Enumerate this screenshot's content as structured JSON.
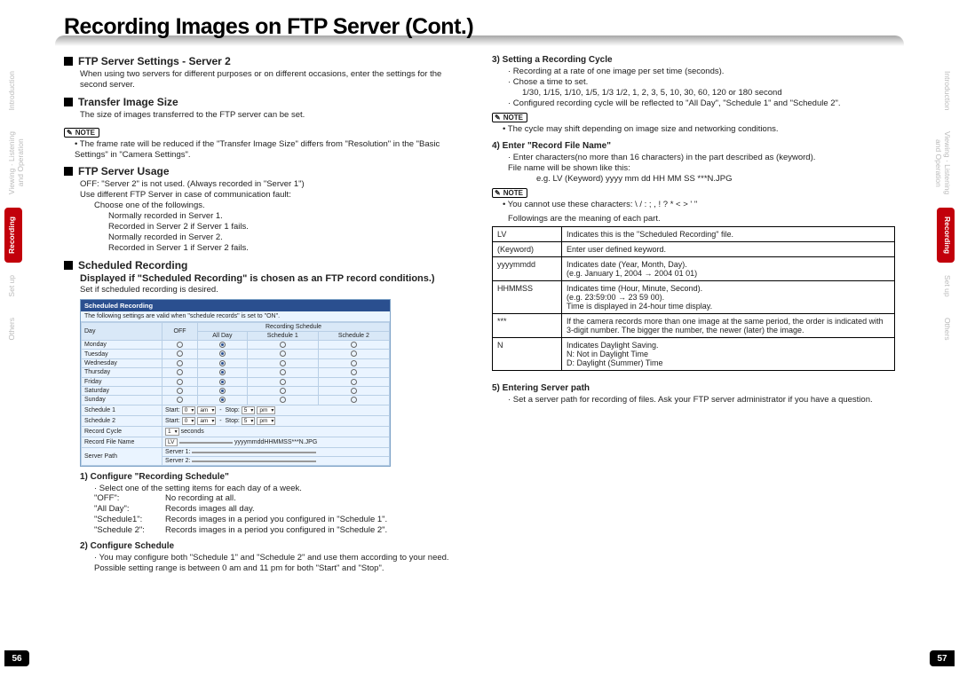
{
  "title": "Recording Images on FTP Server (Cont.)",
  "left_tabs": [
    "Introduction",
    "Viewing · Listening\nand Operation",
    "Recording",
    "Set up",
    "Others"
  ],
  "right_tabs": [
    "Introduction",
    "Viewing · Listening\nand Operation",
    "Recording",
    "Set up",
    "Others"
  ],
  "active_tab": "Recording",
  "page_left": "56",
  "page_right": "57",
  "colA": {
    "s1_h": "FTP Server Settings - Server 2",
    "s1_b": "When using two servers for different purposes or on different occasions, enter the settings for the second server.",
    "s2_h": "Transfer Image Size",
    "s2_b": "The size of images transferred to the FTP server can be set.",
    "note1": "NOTE",
    "note1_b": "The frame rate will be reduced if the \"Transfer Image Size\" differs from \"Resolution\" in the \"Basic Settings\" in \"Camera Settings\".",
    "s3_h": "FTP Server Usage",
    "s3_l1": "OFF:  \"Server 2\" is not used.  (Always recorded in \"Server 1\")",
    "s3_l2": "Use different FTP Server in case of communication fault:",
    "s3_l3": "Choose one of the followings.",
    "s3_l4": "Normally recorded in Server 1.",
    "s3_l5": "Recorded in Server 2 if Server 1 fails.",
    "s3_l6": "Normally recorded in Server 2.",
    "s3_l7": "Recorded in Server 1 if Server 2 fails.",
    "s4_h": "Scheduled Recording",
    "s4_sub": "Displayed if \"Scheduled Recording\" is chosen as an FTP record conditions.)",
    "s4_b": "Set if scheduled recording is desired.",
    "sched_title": "Scheduled Recording",
    "sched_sub": "The following settings are valid when \"schedule records\" is set to \"ON\".",
    "sched_head_day": "Day",
    "sched_head_off": "OFF",
    "sched_head_group": "Recording Schedule",
    "sched_head_c1": "All Day",
    "sched_head_c2": "Schedule 1",
    "sched_head_c3": "Schedule 2",
    "days": [
      "Monday",
      "Tuesday",
      "Wednesday",
      "Thursday",
      "Friday",
      "Saturday",
      "Sunday"
    ],
    "row_s1_label": "Schedule 1",
    "row_s2_label": "Schedule 2",
    "row_cycle_label": "Record Cycle",
    "row_file_label": "Record File Name",
    "row_path_label": "Server Path",
    "row_start": "Start:",
    "row_stop": "Stop:",
    "row_start_v1": "0",
    "row_start_v2": "am",
    "row_stop_v1": "5",
    "row_stop_v2": "pm",
    "row_cycle_v": "1",
    "row_cycle_u": "seconds",
    "row_file_pre": "LV",
    "row_file_v": "yyyymmddHHMMSS***N.JPG",
    "row_path_s1": "Server 1:",
    "row_path_s2": "Server 2:",
    "p1_h": "1) Configure \"Recording Schedule\"",
    "p1_b": "· Select one of the setting items for each day of a week.",
    "p1_k1": "\"OFF\":",
    "p1_v1": "No recording at all.",
    "p1_k2": "\"All Day\":",
    "p1_v2": "Records images all day.",
    "p1_k3": "\"Schedule1\":",
    "p1_v3": "Records images in a period you configured in \"Schedule 1\".",
    "p1_k4": "\"Schedule 2\":",
    "p1_v4": "Records images in a period you configured in \"Schedule 2\".",
    "p2_h": "2) Configure Schedule",
    "p2_b1": "· You may configure both \"Schedule 1\" and \"Schedule 2\" and use them according to your need.",
    "p2_b2": "Possible setting range is between 0 am and 11 pm for both \"Start\" and \"Stop\"."
  },
  "colB": {
    "p3_h": "3) Setting a Recording Cycle",
    "p3_b1": "· Recording at a rate of one image per set time (seconds).",
    "p3_b2": "· Chose a time to set.",
    "p3_b3": "1/30, 1/15, 1/10, 1/5, 1/3 1/2, 1, 2, 3, 5, 10, 30, 60, 120 or 180  second",
    "p3_b4": "· Configured recording cycle will be reflected to \"All Day\", \"Schedule 1\" and \"Schedule 2\".",
    "note2": "NOTE",
    "note2_b": "The cycle may shift depending on image size and networking conditions.",
    "p4_h": "4)  Enter \"Record File Name\"",
    "p4_b1": "· Enter characters(no more than 16 characters) in the part described as (keyword).",
    "p4_b2": "File name will be shown like this:",
    "p4_b3": "e.g. LV (Keyword) yyyy mm dd HH MM SS ***N.JPG",
    "note3": "NOTE",
    "note3_b": "You cannot use these characters: \\ / : ; , ! ? * < > ' \"",
    "meaning_intro": "Followings are the meaning of each part.",
    "m": [
      {
        "k": "LV",
        "v": "Indicates this is the \"Scheduled Recording\" file."
      },
      {
        "k": "(Keyword)",
        "v": "Enter user defined keyword."
      },
      {
        "k": "yyyymmdd",
        "v": "Indicates date (Year, Month, Day).\n(e.g. January 1, 2004 → 2004 01 01)"
      },
      {
        "k": "HHMMSS",
        "v": "Indicates time (Hour, Minute, Second).\n(e.g. 23:59:00 → 23 59 00).\nTime is displayed in 24-hour time display."
      },
      {
        "k": "***",
        "v": "If the camera records more than one image at the same period, the order is indicated with 3-digit number. The bigger the number, the newer (later) the image."
      },
      {
        "k": "N",
        "v": "Indicates Daylight Saving.\nN: Not in Daylight Time\nD: Daylight (Summer) Time"
      }
    ],
    "p5_h": "5)  Entering Server path",
    "p5_b": "· Set a server path for recording of files.  Ask your FTP server administrator if you have a question."
  }
}
